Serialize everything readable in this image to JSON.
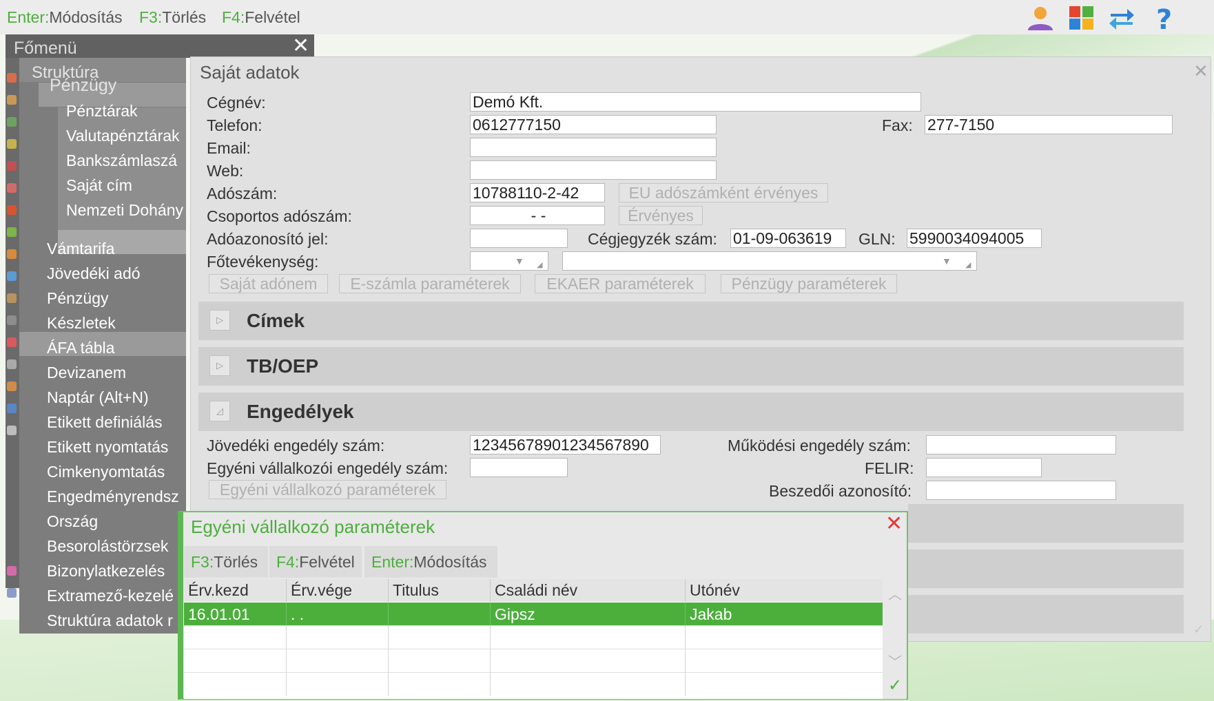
{
  "topbar": {
    "shortcuts": [
      {
        "key": "Enter:",
        "label": "Módosítás"
      },
      {
        "key": "F3:",
        "label": "Törlés"
      },
      {
        "key": "F4:",
        "label": "Felvétel"
      }
    ],
    "icons": [
      "user-icon",
      "windows-grid-icon",
      "swap-arrows-icon",
      "help-icon"
    ]
  },
  "menu": {
    "title": "Főmenü",
    "items": {
      "struktura": "Struktúra",
      "penzugy_group": "Pénzügy",
      "penztarak": "Pénztárak",
      "valutapenztarak": "Valutapénztárak",
      "bankszamla": "Bankszámlaszá",
      "sajat_cim": "Saját cím",
      "nemzeti_dohany": "Nemzeti Dohány",
      "vamtarifa": "Vámtarifa",
      "jovedeki_ado": "Jövedéki adó",
      "penzugy": "Pénzügy",
      "keszletek": "Készletek",
      "afa_tabla": "ÁFA tábla",
      "devizanem": "Devizanem",
      "naptar": "Naptár (Alt+N)",
      "etikett_definialas": "Etikett definiálás",
      "etikett_nyomtatas": "Etikett nyomtatás",
      "cimkenyomtatas": "Cimkenyomtatás",
      "engedmenyrendsz": "Engedményrendsz",
      "orszag": "Ország",
      "besorolastorzsek": "Besorolástörzsek",
      "bizonylatkezeles": "Bizonylatkezelés",
      "extramezo": "Extramező-kezelé",
      "struktura_adatok": "Struktúra adatok r"
    }
  },
  "dialog": {
    "title": "Saját adatok",
    "labels": {
      "cegnev": "Cégnév:",
      "telefon": "Telefon:",
      "fax": "Fax:",
      "email": "Email:",
      "web": "Web:",
      "adoszam": "Adószám:",
      "csoportos": "Csoportos adószám:",
      "adoazonosito": "Adóazonosító jel:",
      "cegjegyzek": "Cégjegyzék szám:",
      "gln": "GLN:",
      "fotevekenyseg": "Főtevékenység:"
    },
    "values": {
      "cegnev": "Demó Kft.",
      "telefon": "0612777150",
      "fax": "277-7150",
      "email": "",
      "web": "",
      "adoszam": "10788110-2-42",
      "csoportos": "- -",
      "adoazonosito": "",
      "cegjegyzek": "01-09-063619",
      "gln": "5990034094005"
    },
    "buttons": {
      "eu_adoszam": "EU adószámként érvényes",
      "ervenyes": "Érvényes",
      "sajat_adonem": "Saját adónem",
      "eszamla": "E-számla paraméterek",
      "ekaer": "EKAER paraméterek",
      "penzugy_param": "Pénzügy paraméterek",
      "egyeni_param": "Egyéni vállalkozó paraméterek"
    },
    "sections": {
      "cimek": "Címek",
      "tb_oep": "TB/OEP",
      "engedelyek": "Engedélyek"
    },
    "engedelyek": {
      "labels": {
        "jovedeki": "Jövedéki engedély szám:",
        "egyeni": "Egyéni vállalkozói engedély szám:",
        "mukodesi": "Működési engedély szám:",
        "felir": "FELIR:",
        "beszedoi": "Beszedői azonosító:"
      },
      "values": {
        "jovedeki": "12345678901234567890",
        "egyeni": "",
        "mukodesi": "",
        "felir": "",
        "beszedoi": ""
      }
    }
  },
  "subdialog": {
    "title": "Egyéni vállalkozó paraméterek",
    "toolbar": [
      {
        "key": "F3:",
        "label": "Törlés"
      },
      {
        "key": "F4:",
        "label": "Felvétel"
      },
      {
        "key": "Enter:",
        "label": "Módosítás"
      }
    ],
    "columns": [
      "Érv.kezd",
      "Érv.vége",
      "Titulus",
      "Családi név",
      "Utónév"
    ],
    "rows": [
      [
        "16.01.01",
        ". .",
        "",
        "Gipsz",
        "Jakab"
      ]
    ]
  },
  "colors": {
    "accent_green": "#4caf3c",
    "menu_gray": "#7d7d7d",
    "close_red": "#e53935"
  }
}
